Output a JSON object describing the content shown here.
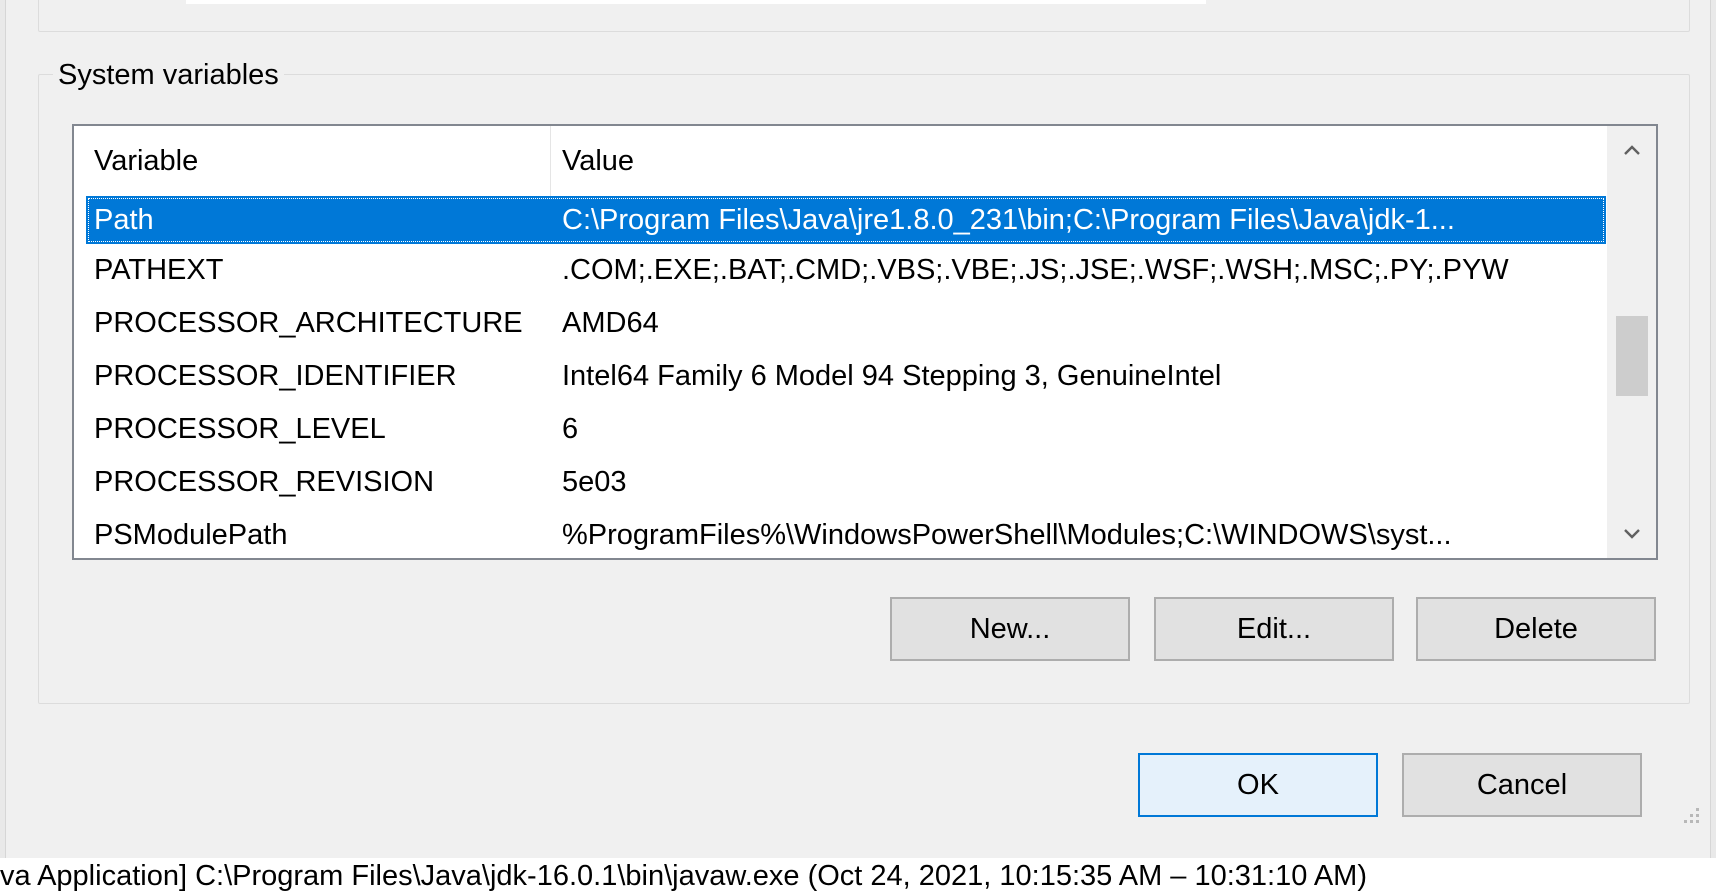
{
  "group": {
    "legend": "System variables"
  },
  "list": {
    "headers": {
      "variable": "Variable",
      "value": "Value"
    },
    "rows": [
      {
        "variable": "Path",
        "value": "C:\\Program Files\\Java\\jre1.8.0_231\\bin;C:\\Program Files\\Java\\jdk-1..."
      },
      {
        "variable": "PATHEXT",
        "value": ".COM;.EXE;.BAT;.CMD;.VBS;.VBE;.JS;.JSE;.WSF;.WSH;.MSC;.PY;.PYW"
      },
      {
        "variable": "PROCESSOR_ARCHITECTURE",
        "value": "AMD64"
      },
      {
        "variable": "PROCESSOR_IDENTIFIER",
        "value": "Intel64 Family 6 Model 94 Stepping 3, GenuineIntel"
      },
      {
        "variable": "PROCESSOR_LEVEL",
        "value": "6"
      },
      {
        "variable": "PROCESSOR_REVISION",
        "value": "5e03"
      },
      {
        "variable": "PSModulePath",
        "value": "%ProgramFiles%\\WindowsPowerShell\\Modules;C:\\WINDOWS\\syst..."
      }
    ],
    "selected_index": 0
  },
  "buttons": {
    "new": "New...",
    "edit": "Edit...",
    "delete": "Delete",
    "ok": "OK",
    "cancel": "Cancel"
  },
  "status": {
    "text": "va Application] C:\\Program Files\\Java\\jdk-16.0.1\\bin\\javaw.exe  (Oct 24, 2021, 10:15:35 AM – 10:31:10 AM)"
  },
  "colors": {
    "selection": "#0078d7",
    "dialog_bg": "#f0f0f0",
    "default_button_border": "#0078d7"
  },
  "icons": {
    "scroll_up": "chevron-up-icon",
    "scroll_down": "chevron-down-icon",
    "grip": "resize-grip-icon"
  }
}
